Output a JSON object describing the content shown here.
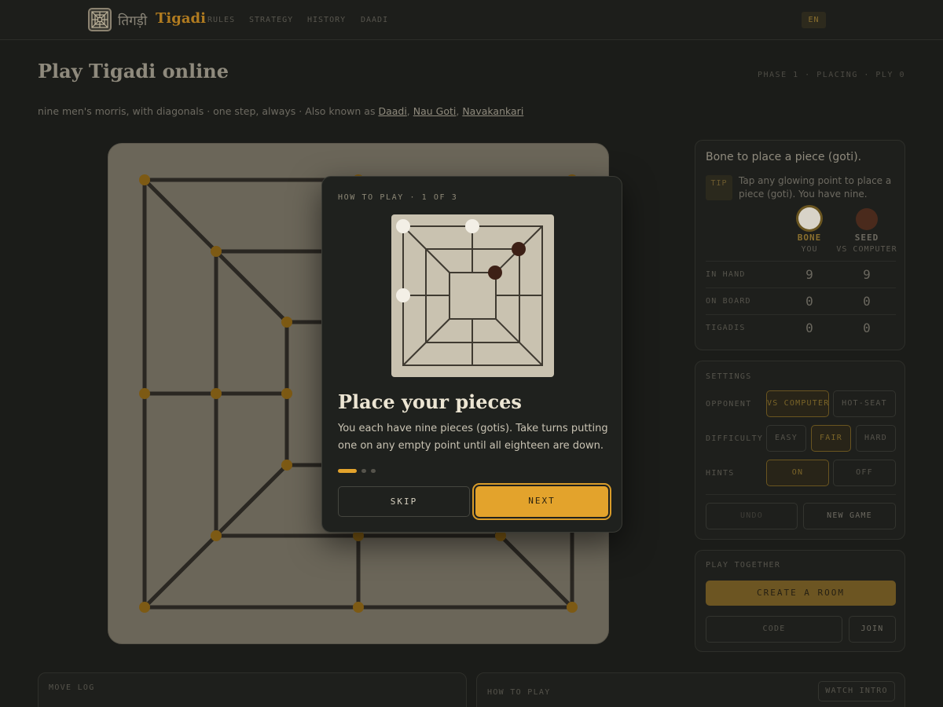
{
  "header": {
    "brand_hindi": "तिगड़ी",
    "brand_name": "Tigadi",
    "nav": [
      "RULES",
      "STRATEGY",
      "HISTORY",
      "DAADI"
    ],
    "language": "EN"
  },
  "page": {
    "title": "Play Tigadi online",
    "phase": "PHASE 1 · PLACING · PLY 0",
    "subtitle_prefix": "nine men's morris, with diagonals · one step, always · Also known as ",
    "aliases": [
      "Daadi",
      "Nau Goti",
      "Navakankari"
    ]
  },
  "status_panel": {
    "turn_text": "Bone to place a piece (goti).",
    "tip_label": "TIP",
    "tip_text": "Tap any glowing point to place a piece (goti). You have nine.",
    "players": [
      {
        "name": "BONE",
        "role": "YOU",
        "color": "#d8d3c8",
        "name_color": "#8a6f2e"
      },
      {
        "name": "SEED",
        "role": "VS COMPUTER",
        "color": "#4a2a1c",
        "name_color": "#6b685f"
      }
    ],
    "stats": [
      {
        "label": "IN HAND",
        "bone": "9",
        "seed": "9"
      },
      {
        "label": "ON BOARD",
        "bone": "0",
        "seed": "0"
      },
      {
        "label": "TIGADIS",
        "bone": "0",
        "seed": "0"
      }
    ]
  },
  "settings": {
    "label": "SETTINGS",
    "opponent_label": "OPPONENT",
    "opponent_options": [
      "VS COMPUTER",
      "HOT-SEAT"
    ],
    "opponent_selected": "VS COMPUTER",
    "difficulty_label": "DIFFICULTY",
    "difficulty_options": [
      "EASY",
      "FAIR",
      "HARD"
    ],
    "difficulty_selected": "FAIR",
    "hints_label": "HINTS",
    "hints_options": [
      "ON",
      "OFF"
    ],
    "hints_selected": "ON",
    "undo_label": "UNDO",
    "new_game_label": "NEW GAME"
  },
  "play_together": {
    "label": "PLAY TOGETHER",
    "create_room": "CREATE A ROOM",
    "code_placeholder": "CODE",
    "join": "JOIN"
  },
  "move_log": {
    "label": "MOVE LOG"
  },
  "how_to_play_panel": {
    "label": "HOW TO PLAY",
    "watch_intro": "WATCH INTRO"
  },
  "modal": {
    "step": "HOW TO PLAY · 1 OF 3",
    "title": "Place your pieces",
    "body": "You each have nine pieces (gotis). Take turns putting one on any empty point until all eighteen are down.",
    "total_steps": 3,
    "current_step": 1,
    "skip": "SKIP",
    "next": "NEXT"
  },
  "colors": {
    "accent": "#e3a32c",
    "bone": "#f3efe6",
    "seed": "#3d2016"
  }
}
